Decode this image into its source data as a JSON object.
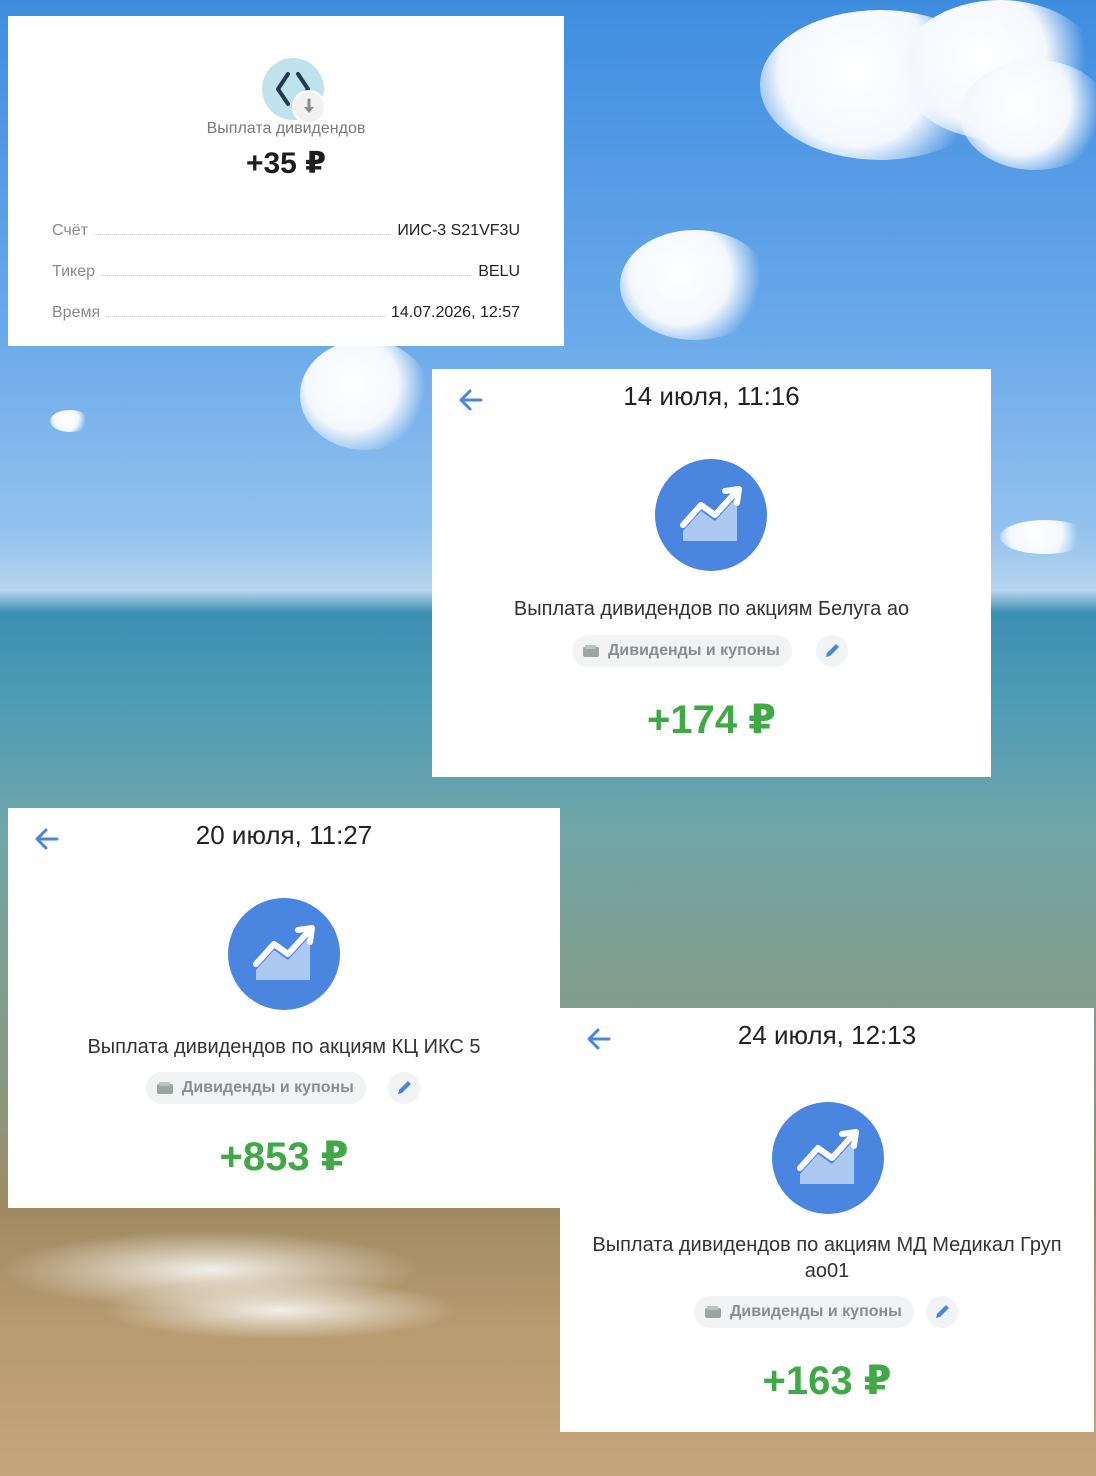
{
  "colors": {
    "accent_blue": "#4a86e0",
    "positive_green": "#3faa45",
    "chip_bg": "#f1f3f5"
  },
  "receipt": {
    "icon": "exchange-arrows-icon",
    "badge_icon": "download-arrow-icon",
    "title": "Выплата дивидендов",
    "amount": "+35 ₽",
    "rows": [
      {
        "label": "Счёт",
        "value": "ИИС-3 S21VF3U"
      },
      {
        "label": "Тикер",
        "value": "BELU"
      },
      {
        "label": "Время",
        "value": "14.07.2026, 12:57"
      }
    ]
  },
  "operations": [
    {
      "date": "14 июля, 11:16",
      "icon": "growth-chart-icon",
      "description": "Выплата дивидендов по акциям Белуга ао",
      "category": "Дивиденды и купоны",
      "amount": "+174 ₽"
    },
    {
      "date": "20 июля, 11:27",
      "icon": "growth-chart-icon",
      "description": "Выплата дивидендов по акциям КЦ ИКС 5",
      "category": "Дивиденды и купоны",
      "amount": "+853 ₽"
    },
    {
      "date": "24 июля, 12:13",
      "icon": "growth-chart-icon",
      "description": "Выплата дивидендов по акциям МД Медикал Груп ао01",
      "category": "Дивиденды и купоны",
      "amount": "+163 ₽"
    }
  ]
}
